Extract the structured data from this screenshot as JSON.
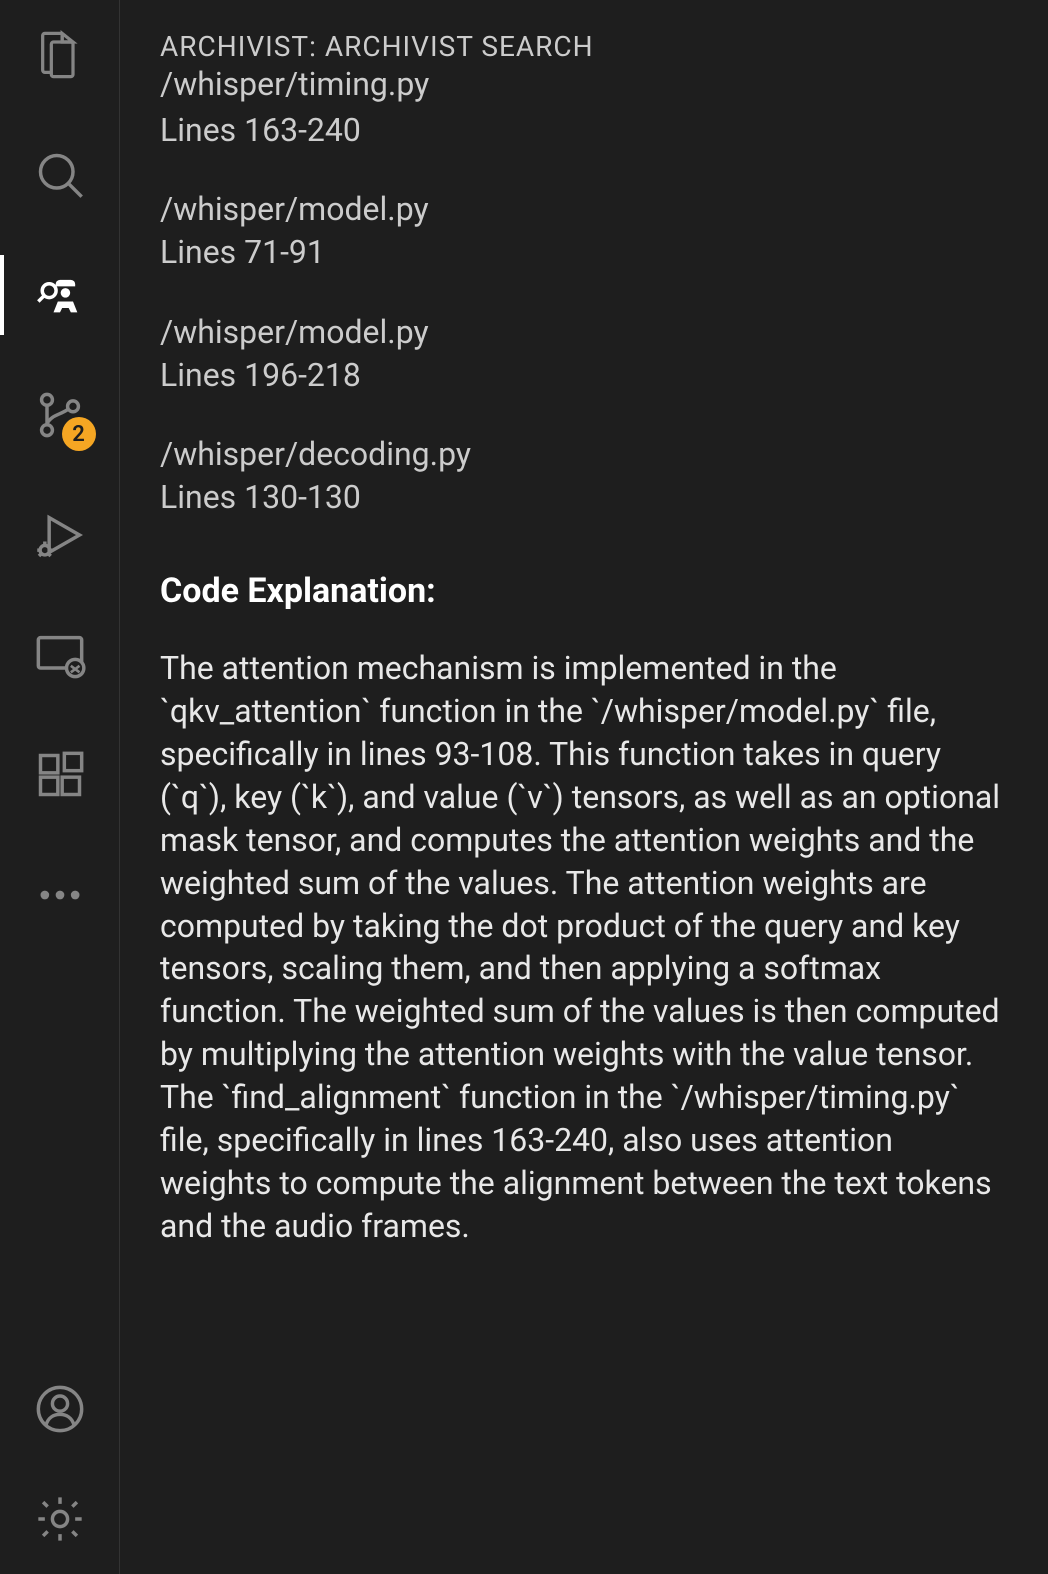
{
  "panel": {
    "title": "ARCHIVIST: ARCHIVIST SEARCH"
  },
  "truncated": {
    "path": "/whisper/timing.py",
    "lines": "Lines 163-240"
  },
  "results": [
    {
      "path": "/whisper/model.py",
      "lines": "Lines 71-91"
    },
    {
      "path": "/whisper/model.py",
      "lines": "Lines 196-218"
    },
    {
      "path": "/whisper/decoding.py",
      "lines": "Lines 130-130"
    }
  ],
  "explanation": {
    "header": "Code Explanation:",
    "body": "The attention mechanism is implemented in the `qkv_attention` function in the `/whisper/model.py` file, specifically in lines 93-108. This function takes in query (`q`), key (`k`), and value (`v`) tensors, as well as an optional mask tensor, and computes the attention weights and the weighted sum of the values. The attention weights are computed by taking the dot product of the query and key tensors, scaling them, and then applying a softmax function. The weighted sum of the values is then computed by multiplying the attention weights with the value tensor. The `find_alignment` function in the `/whisper/timing.py` file, specifically in lines 163-240, also uses attention weights to compute the alignment between the text tokens and the audio frames."
  },
  "source_control_badge": "2"
}
